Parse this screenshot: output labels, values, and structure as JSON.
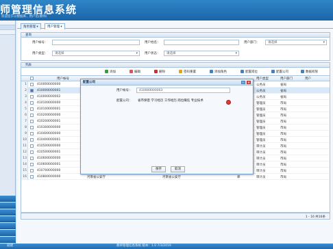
{
  "app": {
    "title": "师管理信息系统",
    "subtitle": "欢迎您于以数据库，用户名(教师)"
  },
  "tabs": [
    {
      "label": "角色管理"
    },
    {
      "label": "用户管理"
    }
  ],
  "search": {
    "header": "查询",
    "fields": [
      {
        "label": "用户帐号：",
        "value": ""
      },
      {
        "label": "用户姓名：",
        "value": ""
      },
      {
        "label": "用户部门：",
        "value": "请选择"
      },
      {
        "label": "用户类型：",
        "value": "请选择"
      },
      {
        "label": "用户状态：",
        "value": "请选择"
      }
    ]
  },
  "list": {
    "header": "列表",
    "toolbar": [
      {
        "label": "添加",
        "icon": "add-icon",
        "color": "#3a9b3a"
      },
      {
        "label": "编辑",
        "icon": "edit-icon",
        "color": "#d9534f"
      },
      {
        "label": "删除",
        "icon": "delete-icon",
        "color": "#c9302c"
      },
      {
        "label": "密码重置",
        "icon": "key-icon",
        "color": "#e0a020"
      },
      {
        "label": "添加角色",
        "icon": "role-icon",
        "color": "#4a7fb5"
      },
      {
        "label": "配置岗位",
        "icon": "post-icon",
        "color": "#4a7fb5"
      },
      {
        "label": "配置公司",
        "icon": "company-icon",
        "color": "#4a7fb5"
      },
      {
        "label": "数据权限",
        "icon": "permission-icon",
        "color": "#4a7fb5"
      }
    ],
    "columns": [
      "用户帐号",
      "用户类型",
      "用户部门",
      "用户"
    ],
    "rows": [
      {
        "num": "1",
        "account": "410000000000",
        "type": "公务员",
        "dept": "省局",
        "selected": false
      },
      {
        "num": "2",
        "account": "410000000001",
        "type": "公务员",
        "dept": "省局",
        "selected": true
      },
      {
        "num": "3",
        "account": "410000000002",
        "type": "公务员",
        "dept": "省局",
        "selected": false
      },
      {
        "num": "4",
        "account": "410100000000",
        "type": "管理员",
        "dept": "市局",
        "selected": false
      },
      {
        "num": "5",
        "account": "410100000001",
        "type": "管理员",
        "dept": "市局",
        "selected": false
      },
      {
        "num": "6",
        "account": "410200000000",
        "type": "管理员",
        "dept": "市局",
        "selected": false
      },
      {
        "num": "7",
        "account": "410200000001",
        "type": "管理员",
        "dept": "市局",
        "selected": false
      },
      {
        "num": "8",
        "account": "410300000000",
        "type": "管理员",
        "dept": "市局",
        "selected": false
      },
      {
        "num": "9",
        "account": "410400000000",
        "type": "管理员",
        "dept": "市局",
        "selected": false
      },
      {
        "num": "10",
        "account": "410400000001",
        "type": "管理员",
        "dept": "市局",
        "selected": false
      },
      {
        "num": "11",
        "account": "410500000000",
        "type": "审计员",
        "dept": "市局",
        "selected": false
      },
      {
        "num": "12",
        "account": "410500000001",
        "type": "审计员",
        "dept": "市局",
        "selected": false
      },
      {
        "num": "13",
        "account": "410600000000",
        "type": "审计员",
        "dept": "市局",
        "selected": false
      },
      {
        "num": "14",
        "account": "410600000001",
        "type": "审计员",
        "dept": "市局",
        "selected": false
      },
      {
        "num": "15",
        "account": "410700000000",
        "type": "审计员",
        "dept": "市局",
        "selected": false
      },
      {
        "num": "16",
        "account": "410800000000",
        "type": "审计员",
        "dept": "市局",
        "selected": false
      }
    ],
    "last_row_extra": {
      "name": "河南省公安厅",
      "dept2": "河南省公安厅",
      "code": "库"
    }
  },
  "pager": {
    "text": "1 - 16 共16条"
  },
  "status": {
    "left": "就绪",
    "center": "教师管理信息系统 版本：1.0 7/3/2019"
  },
  "dialog": {
    "title": "配置公司",
    "account_label": "用户帐号：",
    "account_value": "410000000003",
    "roles_label": "配置公司：",
    "roles_value": "省市保密 学习经历 工作经历 岗位職任 专业技术",
    "save_label": "保存",
    "cancel_label": "取消"
  }
}
